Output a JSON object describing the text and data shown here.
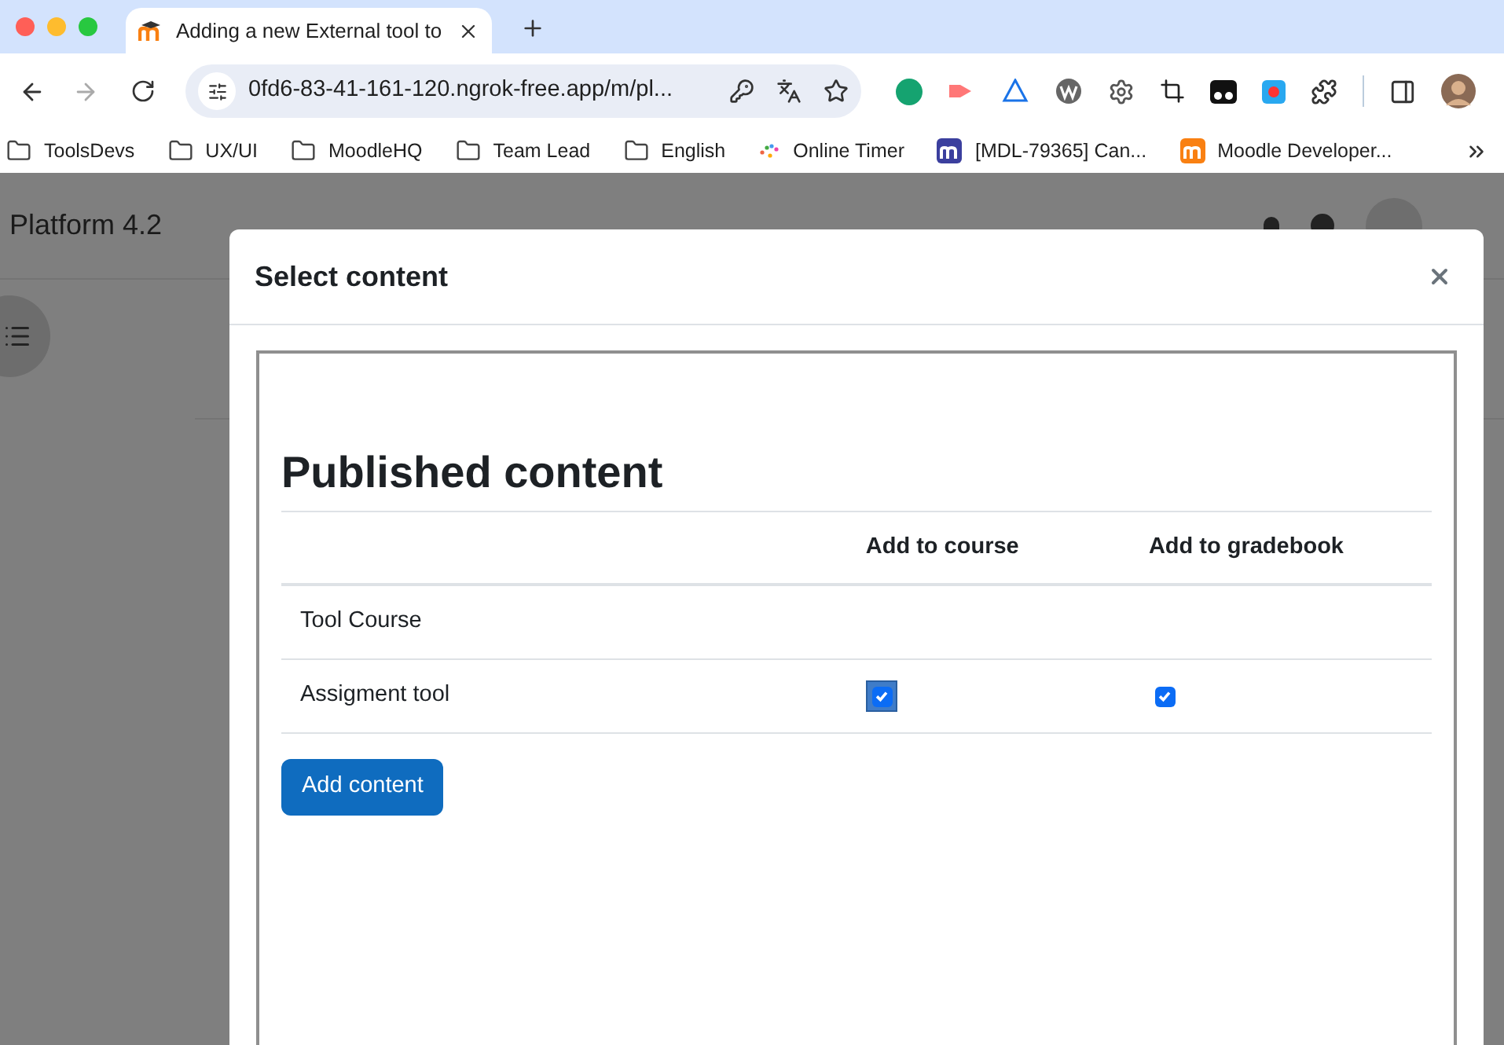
{
  "browser": {
    "tab": {
      "title": "Adding a new External tool to"
    },
    "address": "0fd6-83-41-161-120.ngrok-free.app/m/pl...",
    "bookmarks": [
      {
        "label": "ToolsDevs",
        "kind": "folder"
      },
      {
        "label": "UX/UI",
        "kind": "folder"
      },
      {
        "label": "MoodleHQ",
        "kind": "folder"
      },
      {
        "label": "Team Lead",
        "kind": "folder"
      },
      {
        "label": "English",
        "kind": "folder"
      },
      {
        "label": "Online Timer",
        "kind": "timer"
      },
      {
        "label": "[MDL-79365] Can...",
        "kind": "tracker"
      },
      {
        "label": "Moodle Developer...",
        "kind": "site"
      }
    ]
  },
  "page": {
    "site_name": "Platform 4.2"
  },
  "dialog": {
    "title": "Select content",
    "heading": "Published content",
    "columns": [
      "Add to course",
      "Add to gradebook"
    ],
    "rows": [
      {
        "name": "Tool Course"
      },
      {
        "name": "Assigment tool",
        "options": [
          {
            "checked": true,
            "focused": true
          },
          {
            "checked": true,
            "focused": false
          }
        ]
      }
    ],
    "button": "Add content"
  }
}
